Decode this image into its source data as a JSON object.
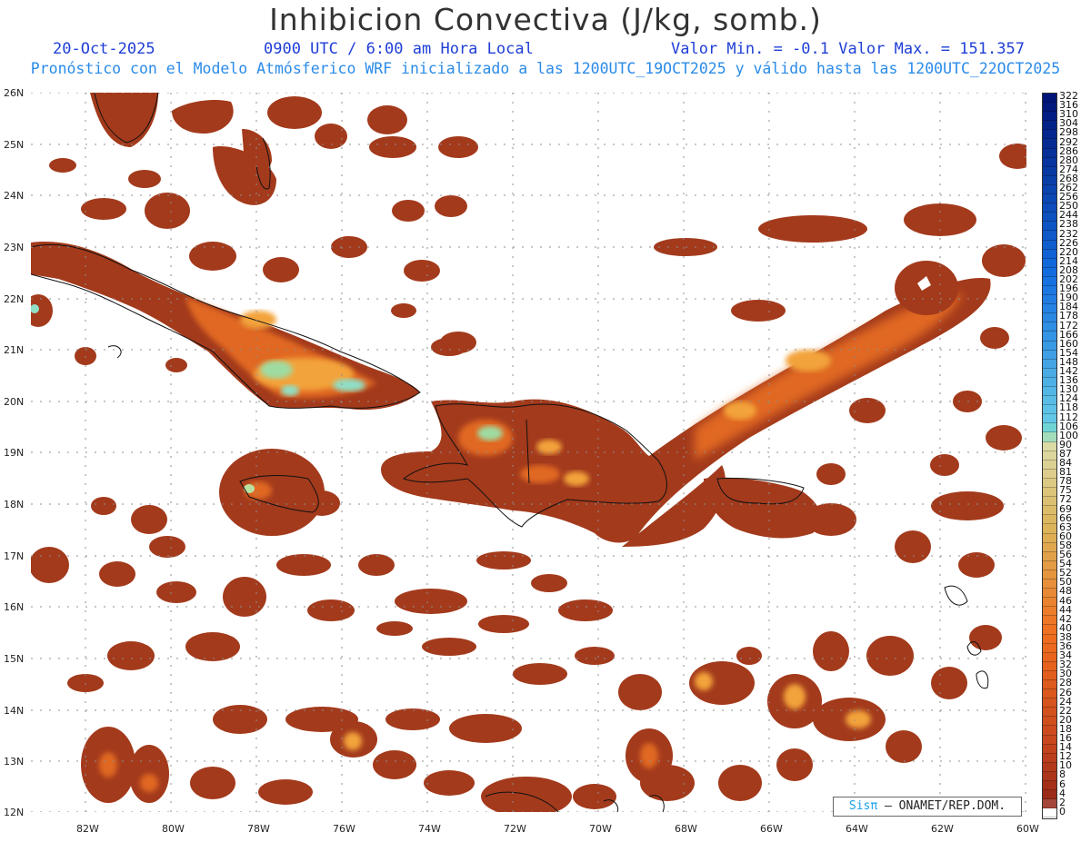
{
  "title": "Inhibicion Convectiva (J/kg, somb.)",
  "header": {
    "date": "20-Oct-2025",
    "time": "0900 UTC / 6:00 am Hora Local",
    "minmax": "Valor Min. = -0.1  Valor Max. = 151.357",
    "forecast": "Pronóstico con el Modelo Atmósferico WRF inicializado a las 1200UTC_19OCT2025 y válido hasta las  1200UTC_22OCT2025"
  },
  "map": {
    "lat_labels": [
      "26N",
      "25N",
      "24N",
      "23N",
      "22N",
      "21N",
      "20N",
      "19N",
      "18N",
      "17N",
      "16N",
      "15N",
      "14N",
      "13N",
      "12N"
    ],
    "lon_labels": [
      "82W",
      "80W",
      "78W",
      "76W",
      "74W",
      "72W",
      "70W",
      "68W",
      "66W",
      "64W",
      "62W",
      "60W"
    ],
    "colors": {
      "low": "#a23a1c",
      "mid": "#e9641c",
      "high": "#a8e09a",
      "peak": "#7ee0c8",
      "coast": "#111111"
    }
  },
  "colorbar": {
    "labels": [
      "322",
      "316",
      "310",
      "304",
      "298",
      "292",
      "286",
      "280",
      "274",
      "268",
      "262",
      "256",
      "250",
      "244",
      "238",
      "232",
      "226",
      "220",
      "214",
      "208",
      "202",
      "196",
      "190",
      "184",
      "178",
      "172",
      "166",
      "160",
      "154",
      "148",
      "142",
      "136",
      "130",
      "124",
      "118",
      "112",
      "106",
      "100",
      "90",
      "87",
      "84",
      "81",
      "78",
      "75",
      "72",
      "69",
      "66",
      "63",
      "60",
      "58",
      "56",
      "54",
      "52",
      "50",
      "48",
      "46",
      "44",
      "42",
      "40",
      "38",
      "36",
      "34",
      "32",
      "30",
      "28",
      "26",
      "24",
      "22",
      "20",
      "18",
      "16",
      "14",
      "12",
      "10",
      "8",
      "6",
      "4",
      "2",
      "0"
    ]
  },
  "credit": {
    "brand": "Sisπ",
    "text": "– ONAMET/REP.DOM."
  }
}
